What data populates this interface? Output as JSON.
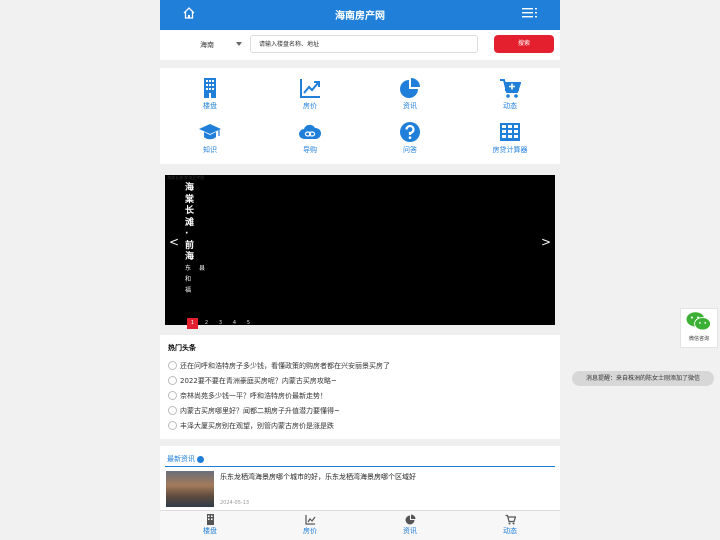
{
  "header": {
    "title": "海南房产网",
    "home_icon": "home-icon",
    "menu_icon": "menu-icon"
  },
  "search": {
    "city": "海南",
    "placeholder": "请输入楼盘名称、地址",
    "button": "搜索"
  },
  "nav": [
    {
      "label": "楼盘",
      "icon": "building-icon"
    },
    {
      "label": "房价",
      "icon": "trend-chart-icon"
    },
    {
      "label": "资讯",
      "icon": "pie-chart-icon"
    },
    {
      "label": "动态",
      "icon": "cart-plus-icon"
    },
    {
      "label": "知识",
      "icon": "graduation-cap-icon"
    },
    {
      "label": "导购",
      "icon": "cloud-link-icon"
    },
    {
      "label": "问答",
      "icon": "question-circle-icon"
    },
    {
      "label": "房贷计算器",
      "icon": "calculator-grid-icon"
    }
  ],
  "banner": {
    "alt": "海棠长滩·前海宣传图",
    "title_vertical": "海棠长滩·前海",
    "sub_vertical": "东和福",
    "sub_right": "县",
    "prev": "<",
    "next": ">",
    "pages": [
      "1",
      "2",
      "3",
      "4",
      "5"
    ],
    "active_page": 1
  },
  "hot": {
    "heading": "热门头条",
    "items": [
      "还在问呼和浩特房子多少钱，看懂政策的购房者都在兴安丽景买房了",
      "2022要不要在青洲豪庭买房呢？内蒙古买房攻略~",
      "奈林尚苑多少钱一平？呼和浩特房价最新走势！",
      "内蒙古买房哪里好？闻都二期房子升值潜力要懂得~",
      "丰泽大厦买房别在观望，别管内蒙古房价是涨是跌"
    ]
  },
  "latest": {
    "heading": "最新资讯",
    "title": "乐东龙栖湾海景房哪个城市的好，乐东龙栖湾海景房哪个区域好",
    "date": "2024-05-13"
  },
  "tabs": [
    {
      "label": "楼盘",
      "icon": "building-icon"
    },
    {
      "label": "房价",
      "icon": "trend-chart-icon"
    },
    {
      "label": "资讯",
      "icon": "pie-chart-icon"
    },
    {
      "label": "动态",
      "icon": "cart-icon"
    }
  ],
  "wechat": {
    "label": "微信咨询",
    "icon": "wechat-icon"
  },
  "notification": "消息提醒：来自株洲的陈女士刚添加了微信",
  "colors": {
    "primary": "#1f7fd9",
    "accent": "#e5202e"
  }
}
